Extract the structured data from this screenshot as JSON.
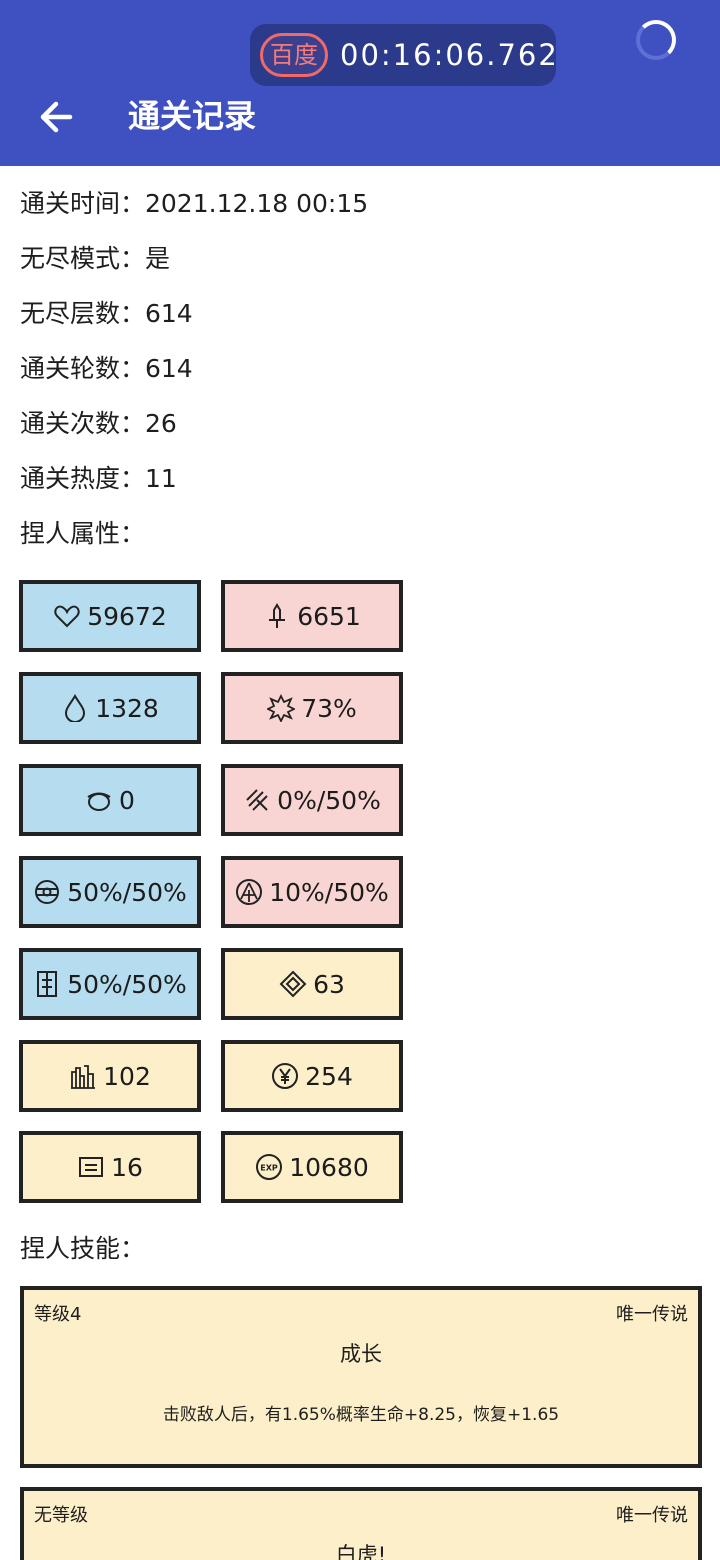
{
  "status_bar": {
    "badge": "百度",
    "timer": "00:16:06.762"
  },
  "header": {
    "title": "通关记录",
    "back_icon": "arrow-left-icon"
  },
  "info": [
    "通关时间：2021.12.18 00:15",
    "无尽模式：是",
    "无尽层数：614",
    "通关轮数：614",
    "通关次数：26",
    "通关热度：11",
    "捏人属性："
  ],
  "stats": [
    {
      "icon": "heart-icon",
      "value": "59672",
      "color": "#b5dcef"
    },
    {
      "icon": "sword-icon",
      "value": "6651",
      "color": "#f8d5d3"
    },
    {
      "icon": "drop-icon",
      "value": "1328",
      "color": "#b5dcef"
    },
    {
      "icon": "burst-icon",
      "value": "73%",
      "color": "#f8d5d3"
    },
    {
      "icon": "helmet-icon",
      "value": "0",
      "color": "#b5dcef"
    },
    {
      "icon": "pierce-icon",
      "value": "0%/50%",
      "color": "#f8d5d3"
    },
    {
      "icon": "dodge-icon",
      "value": "50%/50%",
      "color": "#b5dcef"
    },
    {
      "icon": "crit-icon",
      "value": "10%/50%",
      "color": "#f8d5d3"
    },
    {
      "icon": "shield-icon",
      "value": "50%/50%",
      "color": "#b5dcef"
    },
    {
      "icon": "diamond-icon",
      "value": "63",
      "color": "#fdefc9"
    },
    {
      "icon": "castle-icon",
      "value": "102",
      "color": "#fdefc9"
    },
    {
      "icon": "yen-icon",
      "value": "254",
      "color": "#fdefc9"
    },
    {
      "icon": "card-icon",
      "value": "16",
      "color": "#fdefc9"
    },
    {
      "icon": "exp-icon",
      "value": "10680",
      "color": "#fdefc9"
    }
  ],
  "skills_label": "捏人技能：",
  "skills": [
    {
      "level": "等级4",
      "rarity": "唯一传说",
      "name": "成长",
      "desc": "击败敌人后，有1.65%概率生命+8.25，恢复+1.65"
    },
    {
      "level": "无等级",
      "rarity": "唯一传说",
      "name": "白虎!"
    }
  ]
}
